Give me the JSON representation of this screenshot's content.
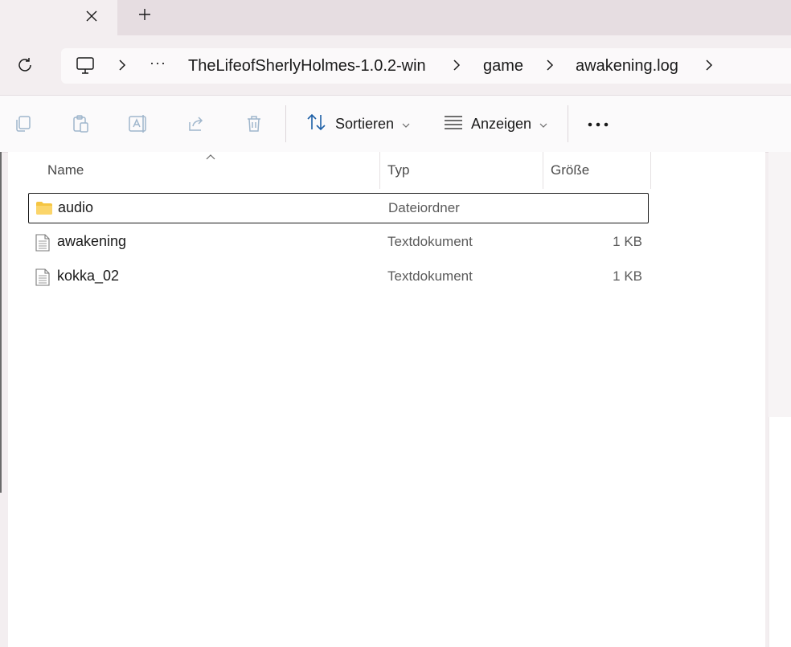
{
  "tabs": {
    "close_icon": "close-icon",
    "new_tab_icon": "plus-icon"
  },
  "address": {
    "overflow": "···",
    "crumbs": [
      "TheLifeofSherlyHolmes-1.0.2-win",
      "game",
      "awakening.log"
    ]
  },
  "toolbar": {
    "sort_label": "Sortieren",
    "view_label": "Anzeigen",
    "disabled_icons": [
      "copy-icon",
      "paste-icon",
      "rename-icon",
      "share-icon",
      "delete-icon"
    ]
  },
  "columns": {
    "name": "Name",
    "type": "Typ",
    "size": "Größe"
  },
  "files": [
    {
      "name": "audio",
      "type": "Dateiordner",
      "size": "",
      "kind": "folder",
      "selected": true
    },
    {
      "name": "awakening",
      "type": "Textdokument",
      "size": "1 KB",
      "kind": "text",
      "selected": false
    },
    {
      "name": "kokka_02",
      "type": "Textdokument",
      "size": "1 KB",
      "kind": "text",
      "selected": false
    }
  ],
  "colors": {
    "accent": "#1d5fa6",
    "folder": "#f5c542",
    "disabled_icon": "#9fb6cc"
  }
}
